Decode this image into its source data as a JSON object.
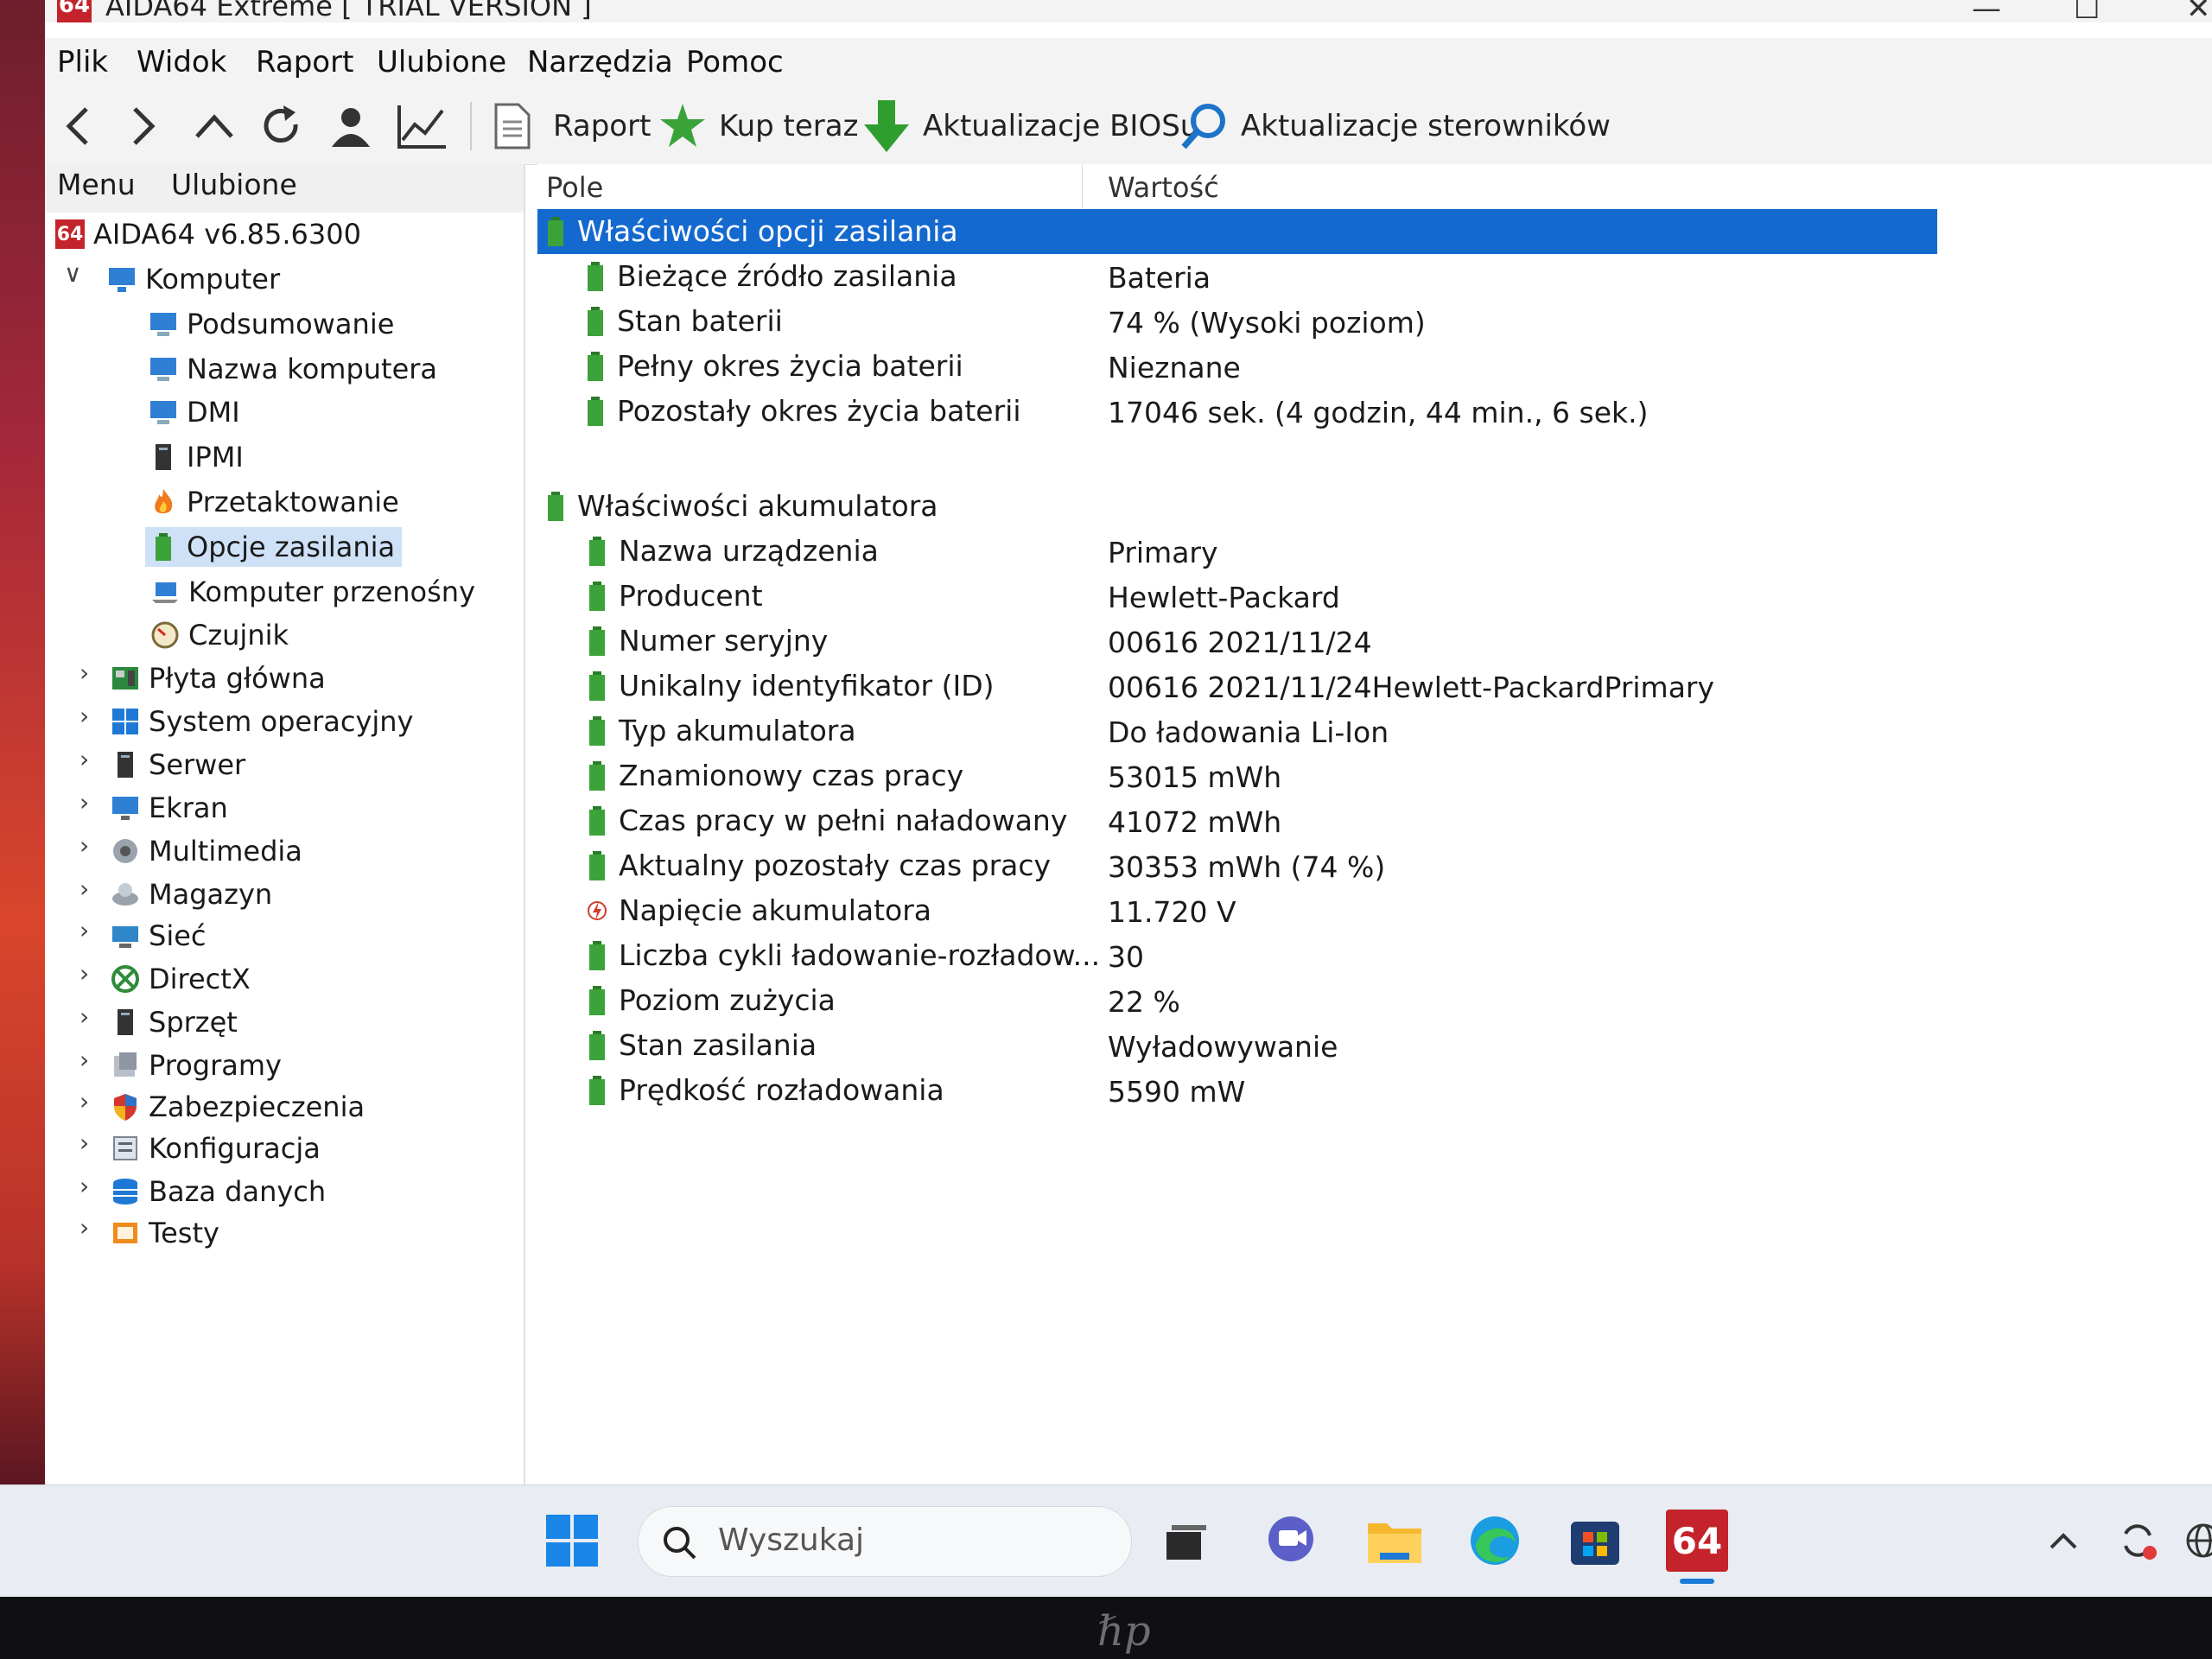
{
  "window": {
    "title": "AIDA64 Extreme  [ TRIAL VERSION ]",
    "app_icon_text": "64"
  },
  "menu": [
    "Plik",
    "Widok",
    "Raport",
    "Ulubione",
    "Narzędzia",
    "Pomoc"
  ],
  "toolbar": {
    "report": "Raport",
    "buy": "Kup teraz",
    "bios": "Aktualizacje BIOSu",
    "drivers": "Aktualizacje sterowników"
  },
  "left_pane": {
    "tabs": [
      "Menu",
      "Ulubione"
    ],
    "root": "AIDA64 v6.85.6300",
    "root_icon_text": "64",
    "computer": "Komputer",
    "computer_children": [
      "Podsumowanie",
      "Nazwa komputera",
      "DMI",
      "IPMI",
      "Przetaktowanie",
      "Opcje zasilania",
      "Komputer przenośny",
      "Czujnik"
    ],
    "categories": [
      "Płyta główna",
      "System operacyjny",
      "Serwer",
      "Ekran",
      "Multimedia",
      "Magazyn",
      "Sieć",
      "DirectX",
      "Sprzęt",
      "Programy",
      "Zabezpieczenia",
      "Konfiguracja",
      "Baza danych",
      "Testy"
    ],
    "selected": "Opcje zasilania"
  },
  "columns": {
    "field": "Pole",
    "value": "Wartość"
  },
  "sections": [
    {
      "title": "Właściwości opcji zasilania",
      "rows": [
        {
          "field": "Bieżące źródło zasilania",
          "value": "Bateria"
        },
        {
          "field": "Stan baterii",
          "value": "74 % (Wysoki poziom)"
        },
        {
          "field": "Pełny okres życia baterii",
          "value": "Nieznane"
        },
        {
          "field": "Pozostały okres życia baterii",
          "value": "17046 sek. (4 godzin, 44 min., 6 sek.)"
        }
      ]
    },
    {
      "title": "Właściwości akumulatora",
      "rows": [
        {
          "field": "Nazwa urządzenia",
          "value": "Primary"
        },
        {
          "field": "Producent",
          "value": "Hewlett-Packard"
        },
        {
          "field": "Numer seryjny",
          "value": "00616 2021/11/24"
        },
        {
          "field": "Unikalny identyfikator (ID)",
          "value": "00616 2021/11/24Hewlett-PackardPrimary"
        },
        {
          "field": "Typ akumulatora",
          "value": "Do ładowania Li-Ion"
        },
        {
          "field": "Znamionowy czas pracy",
          "value": "53015 mWh"
        },
        {
          "field": "Czas pracy w pełni naładowany",
          "value": "41072 mWh"
        },
        {
          "field": "Aktualny pozostały czas pracy",
          "value": "30353 mWh  (74 %)"
        },
        {
          "field": "Napięcie akumulatora",
          "value": "11.720 V"
        },
        {
          "field": "Liczba cykli ładowanie-rozładow...",
          "value": "30"
        },
        {
          "field": "Poziom zużycia",
          "value": "22 %"
        },
        {
          "field": "Stan zasilania",
          "value": "Wyładowywanie"
        },
        {
          "field": "Prędkość rozładowania",
          "value": "5590 mW"
        }
      ]
    }
  ],
  "taskbar": {
    "search_placeholder": "Wyszukaj",
    "aida_icon_text": "64"
  },
  "colors": {
    "selection": "#1469cf",
    "tree_selection": "#cfe1f7",
    "battery_green": "#3ca33a"
  },
  "device_logo": "hp"
}
